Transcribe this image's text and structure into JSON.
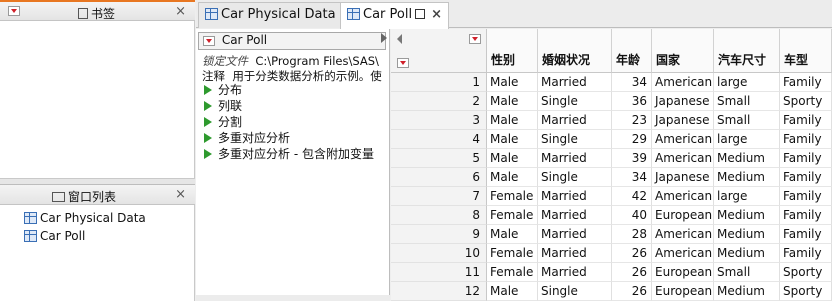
{
  "bookmarks": {
    "title": "书签",
    "close": "×"
  },
  "window_list": {
    "title": "窗口列表",
    "close": "×",
    "items": [
      {
        "label": "Car Physical Data"
      },
      {
        "label": "Car Poll"
      }
    ]
  },
  "tabs": [
    {
      "label": "Car Physical Data",
      "close": "×",
      "active": false
    },
    {
      "label": "Car Poll",
      "close": "×",
      "active": true
    }
  ],
  "table_panel": {
    "name": "Car Poll",
    "locked_file_key": "锁定文件",
    "locked_file_value": "C:\\Program Files\\SAS\\",
    "notes_key": "注释",
    "notes_value": "用于分类数据分析的示例。使",
    "scripts": [
      {
        "label": "分布"
      },
      {
        "label": "列联"
      },
      {
        "label": "分割"
      },
      {
        "label": "多重对应分析"
      },
      {
        "label": "多重对应分析 - 包含附加变量"
      }
    ]
  },
  "grid": {
    "columns": [
      "性别",
      "婚姻状况",
      "年龄",
      "国家",
      "汽车尺寸",
      "车型"
    ],
    "rows": [
      {
        "n": "1",
        "cells": [
          "Male",
          "Married",
          "34",
          "American",
          "large",
          "Family"
        ]
      },
      {
        "n": "2",
        "cells": [
          "Male",
          "Single",
          "36",
          "Japanese",
          "Small",
          "Sporty"
        ]
      },
      {
        "n": "3",
        "cells": [
          "Male",
          "Married",
          "23",
          "Japanese",
          "Small",
          "Family"
        ]
      },
      {
        "n": "4",
        "cells": [
          "Male",
          "Single",
          "29",
          "American",
          "large",
          "Family"
        ]
      },
      {
        "n": "5",
        "cells": [
          "Male",
          "Married",
          "39",
          "American",
          "Medium",
          "Family"
        ]
      },
      {
        "n": "6",
        "cells": [
          "Male",
          "Single",
          "34",
          "Japanese",
          "Medium",
          "Family"
        ]
      },
      {
        "n": "7",
        "cells": [
          "Female",
          "Married",
          "42",
          "American",
          "large",
          "Family"
        ]
      },
      {
        "n": "8",
        "cells": [
          "Female",
          "Married",
          "40",
          "European",
          "Medium",
          "Family"
        ]
      },
      {
        "n": "9",
        "cells": [
          "Male",
          "Married",
          "28",
          "American",
          "Medium",
          "Family"
        ]
      },
      {
        "n": "10",
        "cells": [
          "Female",
          "Married",
          "26",
          "American",
          "Medium",
          "Family"
        ]
      },
      {
        "n": "11",
        "cells": [
          "Female",
          "Married",
          "26",
          "European",
          "Small",
          "Sporty"
        ]
      },
      {
        "n": "12",
        "cells": [
          "Male",
          "Single",
          "26",
          "European",
          "Medium",
          "Sporty"
        ]
      }
    ]
  },
  "colors": {
    "accent_orange": "#e87722",
    "dropdown_red": "#d0202a",
    "script_green": "#2e9a2e"
  }
}
